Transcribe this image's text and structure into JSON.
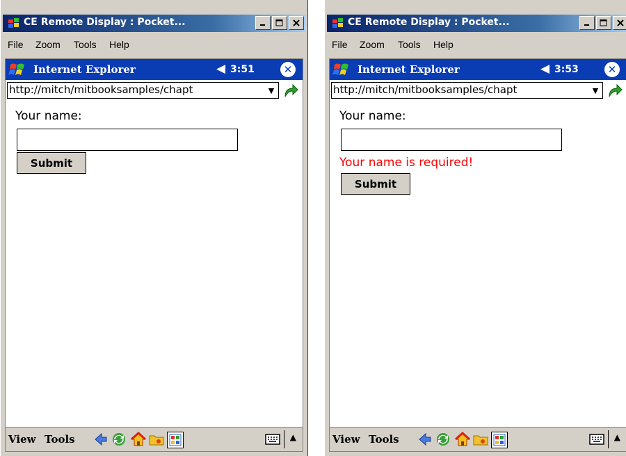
{
  "colors": {
    "titlebar": "#0a246a",
    "ie_nav": "#0a3cb4",
    "error_text": "#ff0000",
    "chrome": "#d4d0c8"
  },
  "left": {
    "window_title": "CE Remote Display : Pocket...",
    "menu": [
      "File",
      "Zoom",
      "Tools",
      "Help"
    ],
    "app_title": "Internet Explorer",
    "time": "3:51",
    "address": "http://mitch/mitbooksamples/chapt",
    "name_label": "Your name:",
    "name_value": "",
    "submit_label": "Submit",
    "bottom_menu": [
      "View",
      "Tools"
    ]
  },
  "right": {
    "window_title": "CE Remote Display : Pocket...",
    "menu": [
      "File",
      "Zoom",
      "Tools",
      "Help"
    ],
    "app_title": "Internet Explorer",
    "time": "3:53",
    "address": "http://mitch/mitbooksamples/chapt",
    "name_label": "Your name:",
    "name_value": "",
    "error_message": "Your name is required!",
    "submit_label": "Submit",
    "bottom_menu": [
      "View",
      "Tools"
    ]
  },
  "icons": {
    "titlebar": [
      "ce-app-icon",
      "minimize-icon",
      "maximize-icon",
      "close-icon"
    ],
    "status": [
      "windows-flag-icon",
      "speaker-icon",
      "close-circle-icon"
    ],
    "address": [
      "dropdown-arrow-icon",
      "go-arrow-icon"
    ],
    "bottom_bar": [
      "back-arrow-icon",
      "refresh-icon",
      "home-icon",
      "favorites-folder-icon",
      "fit-to-screen-icon",
      "keyboard-icon",
      "sip-up-arrow-icon"
    ]
  }
}
